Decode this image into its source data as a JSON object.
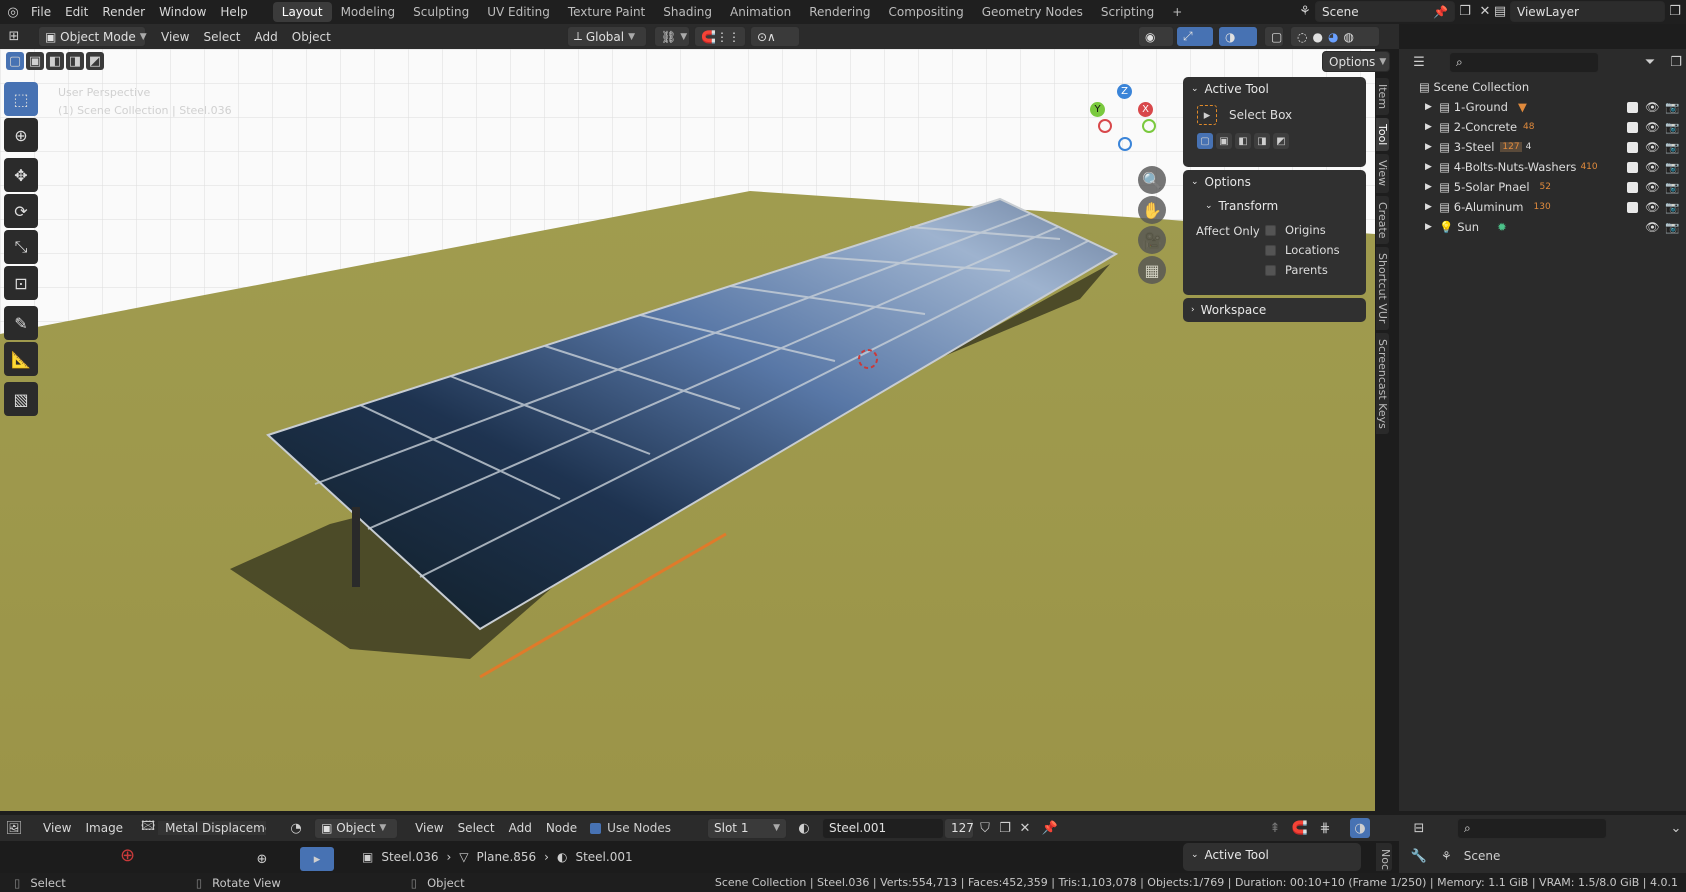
{
  "topbar": {
    "menus": [
      "File",
      "Edit",
      "Render",
      "Window",
      "Help"
    ],
    "workspaces": [
      "Layout",
      "Modeling",
      "Sculpting",
      "UV Editing",
      "Texture Paint",
      "Shading",
      "Animation",
      "Rendering",
      "Compositing",
      "Geometry Nodes",
      "Scripting",
      "+"
    ],
    "active_workspace": "Layout",
    "scene": "Scene",
    "view_layer": "ViewLayer"
  },
  "header3d": {
    "mode": "Object Mode",
    "menus": [
      "View",
      "Select",
      "Add",
      "Object"
    ],
    "orientation": "Global",
    "options": "Options"
  },
  "viewport": {
    "overlay_line1": "User Perspective",
    "overlay_line2": "(1) Scene Collection | Steel.036",
    "gizmo_z": "Z",
    "gizmo_y": "Y",
    "gizmo_x": "X"
  },
  "npanel": {
    "active_tool_title": "Active Tool",
    "tool_name": "Select Box",
    "options_title": "Options",
    "transform_title": "Transform",
    "affect_only": "Affect Only",
    "origins": "Origins",
    "locations": "Locations",
    "parents": "Parents",
    "workspace_title": "Workspace",
    "tabs": [
      "Item",
      "Tool",
      "View",
      "Create",
      "Shortcut VUr",
      "Screencast Keys"
    ]
  },
  "outliner": {
    "root": "Scene Collection",
    "rows": [
      {
        "name": "1-Ground",
        "badge": ""
      },
      {
        "name": "2-Concrete",
        "badge": "48"
      },
      {
        "name": "3-Steel",
        "badge": "127",
        "badge2": "4"
      },
      {
        "name": "4-Bolts-Nuts-Washers",
        "badge": "410"
      },
      {
        "name": "5-Solar Pnael",
        "badge": "52"
      },
      {
        "name": "6-Aluminum",
        "badge": "130"
      },
      {
        "name": "Sun",
        "badge": ""
      }
    ]
  },
  "shader_header": {
    "menus1": [
      "View",
      "Image"
    ],
    "image_name": "Metal Displacement.",
    "object": "Object",
    "menus2": [
      "View",
      "Select",
      "Add",
      "Node"
    ],
    "use_nodes": "Use Nodes",
    "slot": "Slot 1",
    "material": "Steel.001",
    "users": "127",
    "breadcrumb": [
      "Steel.036",
      "Plane.856",
      "Steel.001"
    ],
    "active_tool": "Active Tool",
    "node_tab": "Noc"
  },
  "properties": {
    "scene": "Scene"
  },
  "statusbar": {
    "select": "Select",
    "rotate": "Rotate View",
    "object": "Object",
    "info": "Scene Collection | Steel.036 | Verts:554,713 | Faces:452,359 | Tris:1,103,078 | Objects:1/769 | Duration: 00:10+10 (Frame 1/250) | Memory: 1.1 GiB | VRAM: 1.5/8.0 GiB | 4.0.1"
  }
}
